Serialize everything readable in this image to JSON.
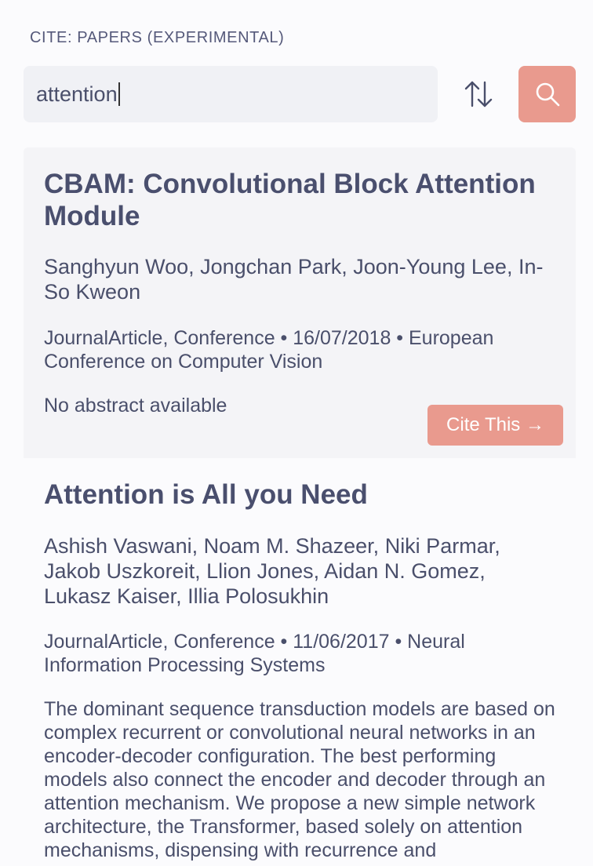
{
  "header": {
    "title": "CITE: PAPERS (EXPERIMENTAL)"
  },
  "search": {
    "value": "attention"
  },
  "results": [
    {
      "title": "CBAM: Convolutional Block Attention Module",
      "authors": "Sanghyun Woo, Jongchan Park, Joon-Young Lee, In-So Kweon",
      "meta": "JournalArticle, Conference • 16/07/2018 • European Conference on Computer Vision",
      "abstract": "No abstract available",
      "cite_label": "Cite This →"
    },
    {
      "title": "Attention is All you Need",
      "authors": "Ashish Vaswani, Noam M. Shazeer, Niki Parmar, Jakob Uszkoreit, Llion Jones, Aidan N. Gomez, Lukasz Kaiser, Illia Polosukhin",
      "meta": "JournalArticle, Conference • 11/06/2017 • Neural Information Processing Systems",
      "abstract": "The dominant sequence transduction models are based on complex recurrent or convolutional neural networks in an encoder-decoder configuration. The best performing models also connect the encoder and decoder through an attention mechanism. We propose a new simple network architecture, the Transformer, based solely on attention mechanisms, dispensing with recurrence and"
    }
  ],
  "icons": {
    "sort": "sort-arrows-icon",
    "search": "search-icon"
  },
  "colors": {
    "accent": "#e99a8e",
    "text": "#4a4f6b",
    "card_bg": "#f4f4f7",
    "input_bg": "#f0f1f5"
  }
}
